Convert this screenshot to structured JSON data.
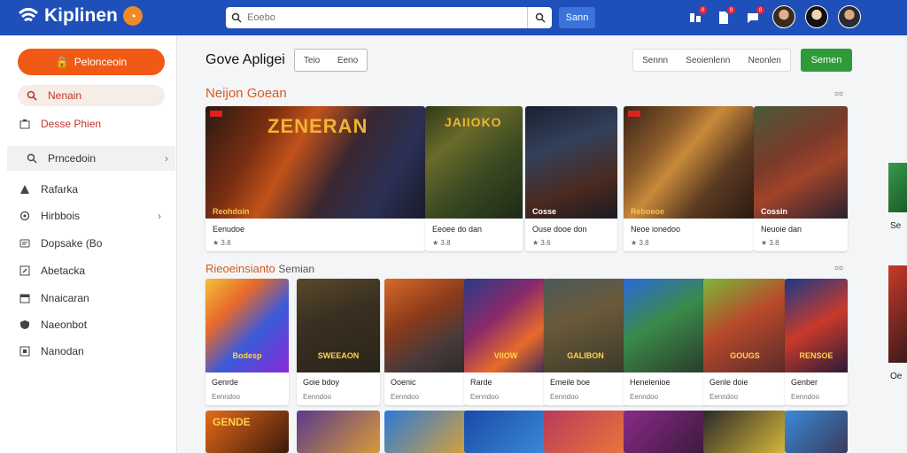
{
  "header": {
    "logo_text": "Kiplinen",
    "search_placeholder": "Eoebo",
    "scan_label": "Sann",
    "badges": [
      "8",
      "9",
      "8"
    ]
  },
  "sidebar": {
    "primary_button": "Pelonceoin",
    "items": [
      {
        "label": "Nenain",
        "icon": "search-icon"
      },
      {
        "label": "Desse Phien",
        "icon": "store-icon"
      },
      {
        "label": "Prncedoin",
        "icon": "search-icon"
      },
      {
        "label": "Rafarka",
        "icon": "warning-icon"
      },
      {
        "label": "Hirbbois",
        "icon": "location-icon"
      },
      {
        "label": "Dopsake (Bo",
        "icon": "message-icon"
      },
      {
        "label": "Abetacka",
        "icon": "edit-icon"
      },
      {
        "label": "Nnaicaran",
        "icon": "calendar-icon"
      },
      {
        "label": "Naeonbot",
        "icon": "shield-icon"
      },
      {
        "label": "Nanodan",
        "icon": "box-icon"
      }
    ]
  },
  "toolbar": {
    "title": "Gove Apligei",
    "segment_a": "Teio",
    "segment_b": "Eeno",
    "filter_a": "Sennn",
    "filter_b": "Seoienlenn",
    "filter_c": "Neonlen",
    "green_button": "Semen"
  },
  "sections": {
    "featured_title": "Neijon Goean",
    "featured_more": "¤¤",
    "grid_title": "Rieoeinsianto",
    "grid_title_extra": "Semian",
    "grid_more": "¤¤"
  },
  "featured": [
    {
      "big_title": "ZENERAN",
      "caption": "Reohdoin",
      "name": "Eenudoe",
      "rating": "★ 3.8"
    },
    {
      "big_title": "JAIIOKO",
      "caption": "",
      "name": "Eeoee do dan",
      "rating": "★ 3.8"
    },
    {
      "big_title": "",
      "caption": "Cosse",
      "name": "Ouse dooe don",
      "rating": "★ 3.6"
    },
    {
      "big_title": "",
      "caption": "Reboeoe",
      "name": "Neoe ionedoo",
      "rating": "★ 3.8"
    },
    {
      "big_title": "",
      "caption": "Cossin",
      "name": "Neuoie dan",
      "rating": "★ 3.8"
    }
  ],
  "grid": [
    {
      "name": "Genrde",
      "sub": "Eenndoo",
      "title": "Bodesp"
    },
    {
      "name": "Goie bdoy",
      "sub": "Eenndoo",
      "title": "SWEEAON"
    },
    {
      "name": "Ooenic",
      "sub": "Eenndoo",
      "title": ""
    },
    {
      "name": "Rarde",
      "sub": "Eenndoo",
      "title": "VIIOW"
    },
    {
      "name": "Emeile boe",
      "sub": "Eenndoo",
      "title": "GALIBON"
    },
    {
      "name": "Henelenioe",
      "sub": "Eenndoo",
      "title": ""
    },
    {
      "name": "Genle doie",
      "sub": "Eenndoo",
      "title": "GOUGS"
    },
    {
      "name": "Genber",
      "sub": "Eenndoo",
      "title": "RENSOE"
    }
  ],
  "grid_row2": [
    {
      "title": "GENDE"
    },
    {
      "title": ""
    },
    {
      "title": ""
    },
    {
      "title": ""
    },
    {
      "title": ""
    },
    {
      "title": ""
    },
    {
      "title": ""
    },
    {
      "title": ""
    }
  ],
  "edge": {
    "a": "Se",
    "b": "Oe"
  },
  "colors": {
    "header_blue": "#1f4fb8",
    "primary_orange": "#f15a15",
    "accent_green": "#2e9a3a",
    "section_orange": "#d55a20"
  }
}
